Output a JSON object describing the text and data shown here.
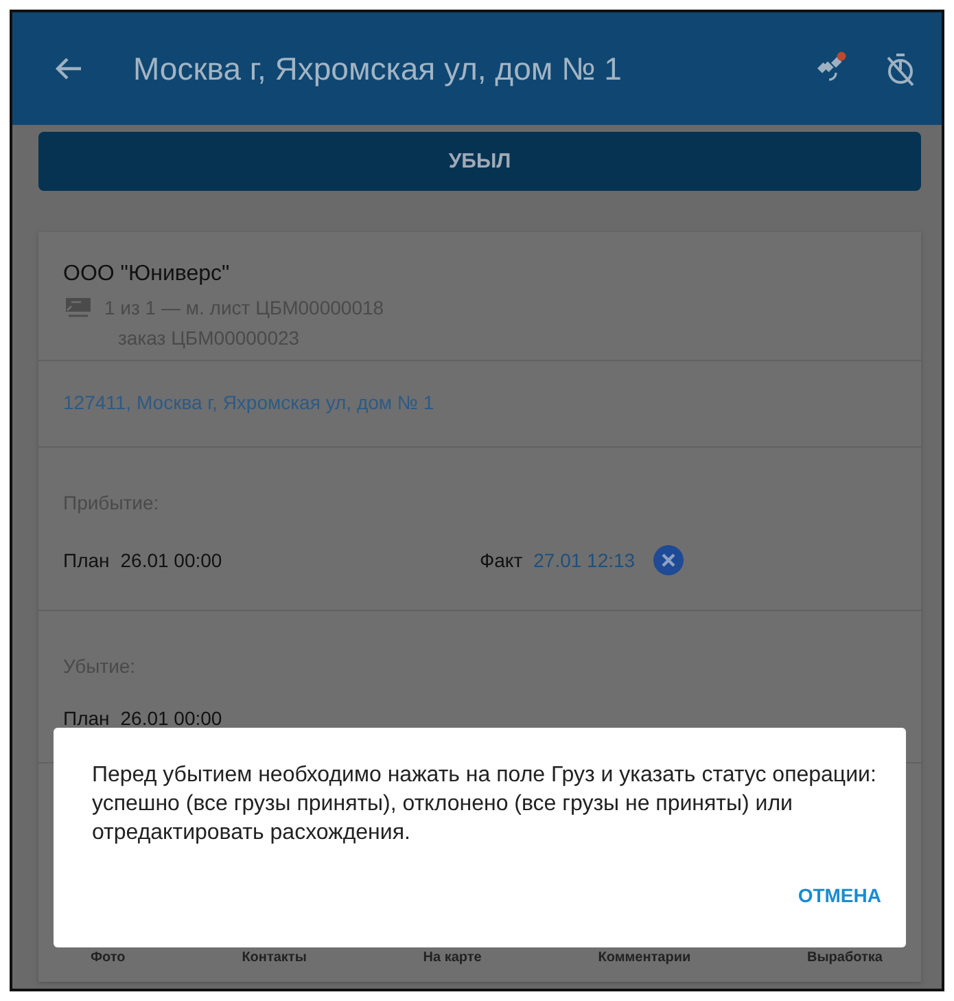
{
  "header": {
    "title": "Москва г, Яхромская ул, дом № 1"
  },
  "action_button": "УБЫЛ",
  "client": {
    "name": "ООО \"Юниверс\"",
    "route": "1 из 1 — м. лист ЦБМ00000018",
    "order": "заказ ЦБМ00000023"
  },
  "address": "127411, Москва г, Яхромская ул, дом № 1",
  "arrival": {
    "label": "Прибытие:",
    "plan_label": "План",
    "plan": "26.01 00:00",
    "fact_label": "Факт",
    "fact": "27.01 12:13"
  },
  "departure": {
    "label": "Убытие:",
    "plan_label": "План",
    "plan": "26.01 00:00"
  },
  "toolbar": [
    {
      "label": "Фото"
    },
    {
      "label": "Контакты"
    },
    {
      "label": "На карте"
    },
    {
      "label": "Комментарии"
    },
    {
      "label": "Выработка"
    }
  ],
  "dialog": {
    "message": "Перед убытием необходимо нажать на поле Груз и указать статус операции: успешно (все грузы приняты), отклонено (все грузы не приняты) или отредактировать расхождения.",
    "buttons": [
      "ОТМЕНА"
    ]
  }
}
